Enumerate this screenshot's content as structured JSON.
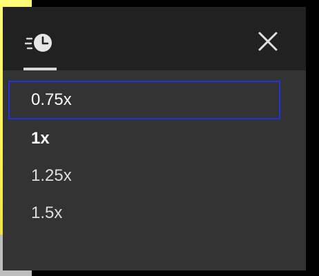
{
  "tabs": [
    {
      "icon": "playback-speed-icon",
      "active": true
    }
  ],
  "close": {
    "icon": "close-icon"
  },
  "speed_options": [
    {
      "label": "0.75x",
      "state": "focused"
    },
    {
      "label": "1x",
      "state": "selected"
    },
    {
      "label": "1.25x",
      "state": "normal"
    },
    {
      "label": "1.5x",
      "state": "normal"
    }
  ],
  "colors": {
    "panel_bg": "#333333",
    "header_bg": "#212121",
    "focus_outline": "#2233dd",
    "text": "#dedede",
    "text_selected": "#ffffff"
  }
}
